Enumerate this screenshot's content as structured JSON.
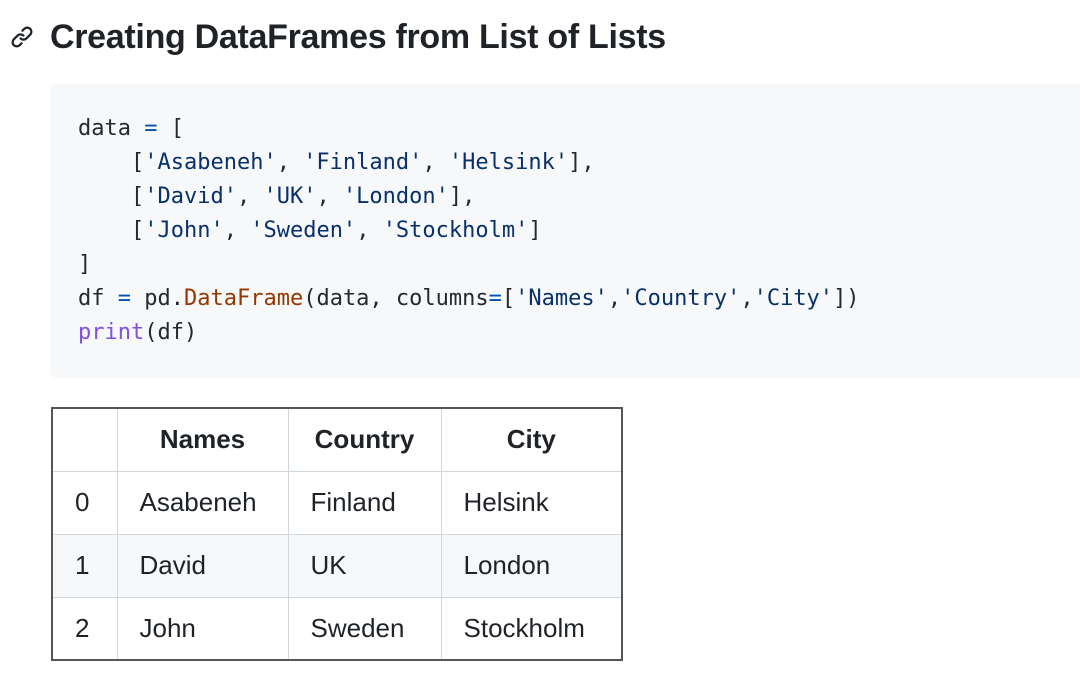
{
  "heading": {
    "icon": "link-icon",
    "title": "Creating DataFrames from List of Lists"
  },
  "code": {
    "lines": [
      [
        {
          "t": "data ",
          "k": "plain"
        },
        {
          "t": "=",
          "k": "op"
        },
        {
          "t": " [",
          "k": "plain"
        }
      ],
      [
        {
          "t": "    [",
          "k": "plain"
        },
        {
          "t": "'Asabeneh'",
          "k": "str"
        },
        {
          "t": ", ",
          "k": "plain"
        },
        {
          "t": "'Finland'",
          "k": "str"
        },
        {
          "t": ", ",
          "k": "plain"
        },
        {
          "t": "'Helsink'",
          "k": "str"
        },
        {
          "t": "],",
          "k": "plain"
        }
      ],
      [
        {
          "t": "    [",
          "k": "plain"
        },
        {
          "t": "'David'",
          "k": "str"
        },
        {
          "t": ", ",
          "k": "plain"
        },
        {
          "t": "'UK'",
          "k": "str"
        },
        {
          "t": ", ",
          "k": "plain"
        },
        {
          "t": "'London'",
          "k": "str"
        },
        {
          "t": "],",
          "k": "plain"
        }
      ],
      [
        {
          "t": "    [",
          "k": "plain"
        },
        {
          "t": "'John'",
          "k": "str"
        },
        {
          "t": ", ",
          "k": "plain"
        },
        {
          "t": "'Sweden'",
          "k": "str"
        },
        {
          "t": ", ",
          "k": "plain"
        },
        {
          "t": "'Stockholm'",
          "k": "str"
        },
        {
          "t": "]",
          "k": "plain"
        }
      ],
      [
        {
          "t": "]",
          "k": "plain"
        }
      ],
      [
        {
          "t": "df ",
          "k": "plain"
        },
        {
          "t": "=",
          "k": "op"
        },
        {
          "t": " pd.",
          "k": "plain"
        },
        {
          "t": "DataFrame",
          "k": "fn"
        },
        {
          "t": "(data, columns",
          "k": "plain"
        },
        {
          "t": "=",
          "k": "op"
        },
        {
          "t": "[",
          "k": "plain"
        },
        {
          "t": "'Names'",
          "k": "str"
        },
        {
          "t": ",",
          "k": "plain"
        },
        {
          "t": "'Country'",
          "k": "str"
        },
        {
          "t": ",",
          "k": "plain"
        },
        {
          "t": "'City'",
          "k": "str"
        },
        {
          "t": "])",
          "k": "plain"
        }
      ],
      [
        {
          "t": "print",
          "k": "builtin"
        },
        {
          "t": "(df)",
          "k": "plain"
        }
      ]
    ]
  },
  "table": {
    "headers": [
      "",
      "Names",
      "Country",
      "City"
    ],
    "rows": [
      [
        "0",
        "Asabeneh",
        "Finland",
        "Helsink"
      ],
      [
        "1",
        "David",
        "UK",
        "London"
      ],
      [
        "2",
        "John",
        "Sweden",
        "Stockholm"
      ]
    ]
  },
  "colors": {
    "string": "#0a3069",
    "operator": "#0550ae",
    "function": "#953800",
    "builtin": "#8250df",
    "code_background": "#f6f8fa",
    "table_border": "#555555"
  }
}
